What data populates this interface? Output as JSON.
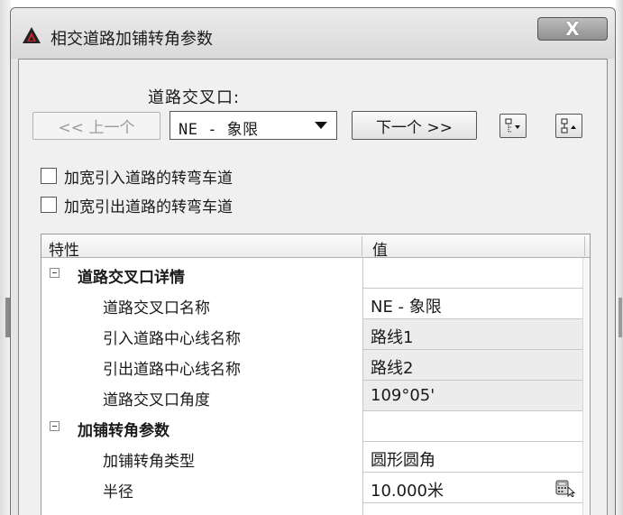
{
  "dialog": {
    "title": "相交道路加铺转角参数",
    "close_label": "X"
  },
  "navigation": {
    "intersection_label": "道路交叉口:",
    "prev_label": "<< 上一个",
    "quadrant_value": "NE - 象限",
    "next_label": "下一个 >>"
  },
  "checkboxes": {
    "widen_entry_label": "加宽引入道路的转弯车道",
    "widen_exit_label": "加宽引出道路的转弯车道"
  },
  "grid": {
    "header_property": "特性",
    "header_value": "值",
    "cat1": {
      "name": "道路交叉口详情"
    },
    "row_name": {
      "name": "道路交叉口名称",
      "value": "NE - 象限"
    },
    "row_entry": {
      "name": "引入道路中心线名称",
      "value": "路线1"
    },
    "row_exit": {
      "name": "引出道路中心线名称",
      "value": "路线2"
    },
    "row_angle": {
      "name": "道路交叉口角度",
      "value": "109°05'"
    },
    "cat2": {
      "name": "加铺转角参数"
    },
    "row_type": {
      "name": "加铺转角类型",
      "value": "圆形圆角"
    },
    "row_radius": {
      "name": "半径",
      "value": "10.000米"
    }
  },
  "icons": {
    "app": "autocad-app-icon",
    "collapse_all": "collapse-all-icon",
    "expand_all": "expand-all-icon",
    "pick_value": "calculator-pick-icon"
  }
}
